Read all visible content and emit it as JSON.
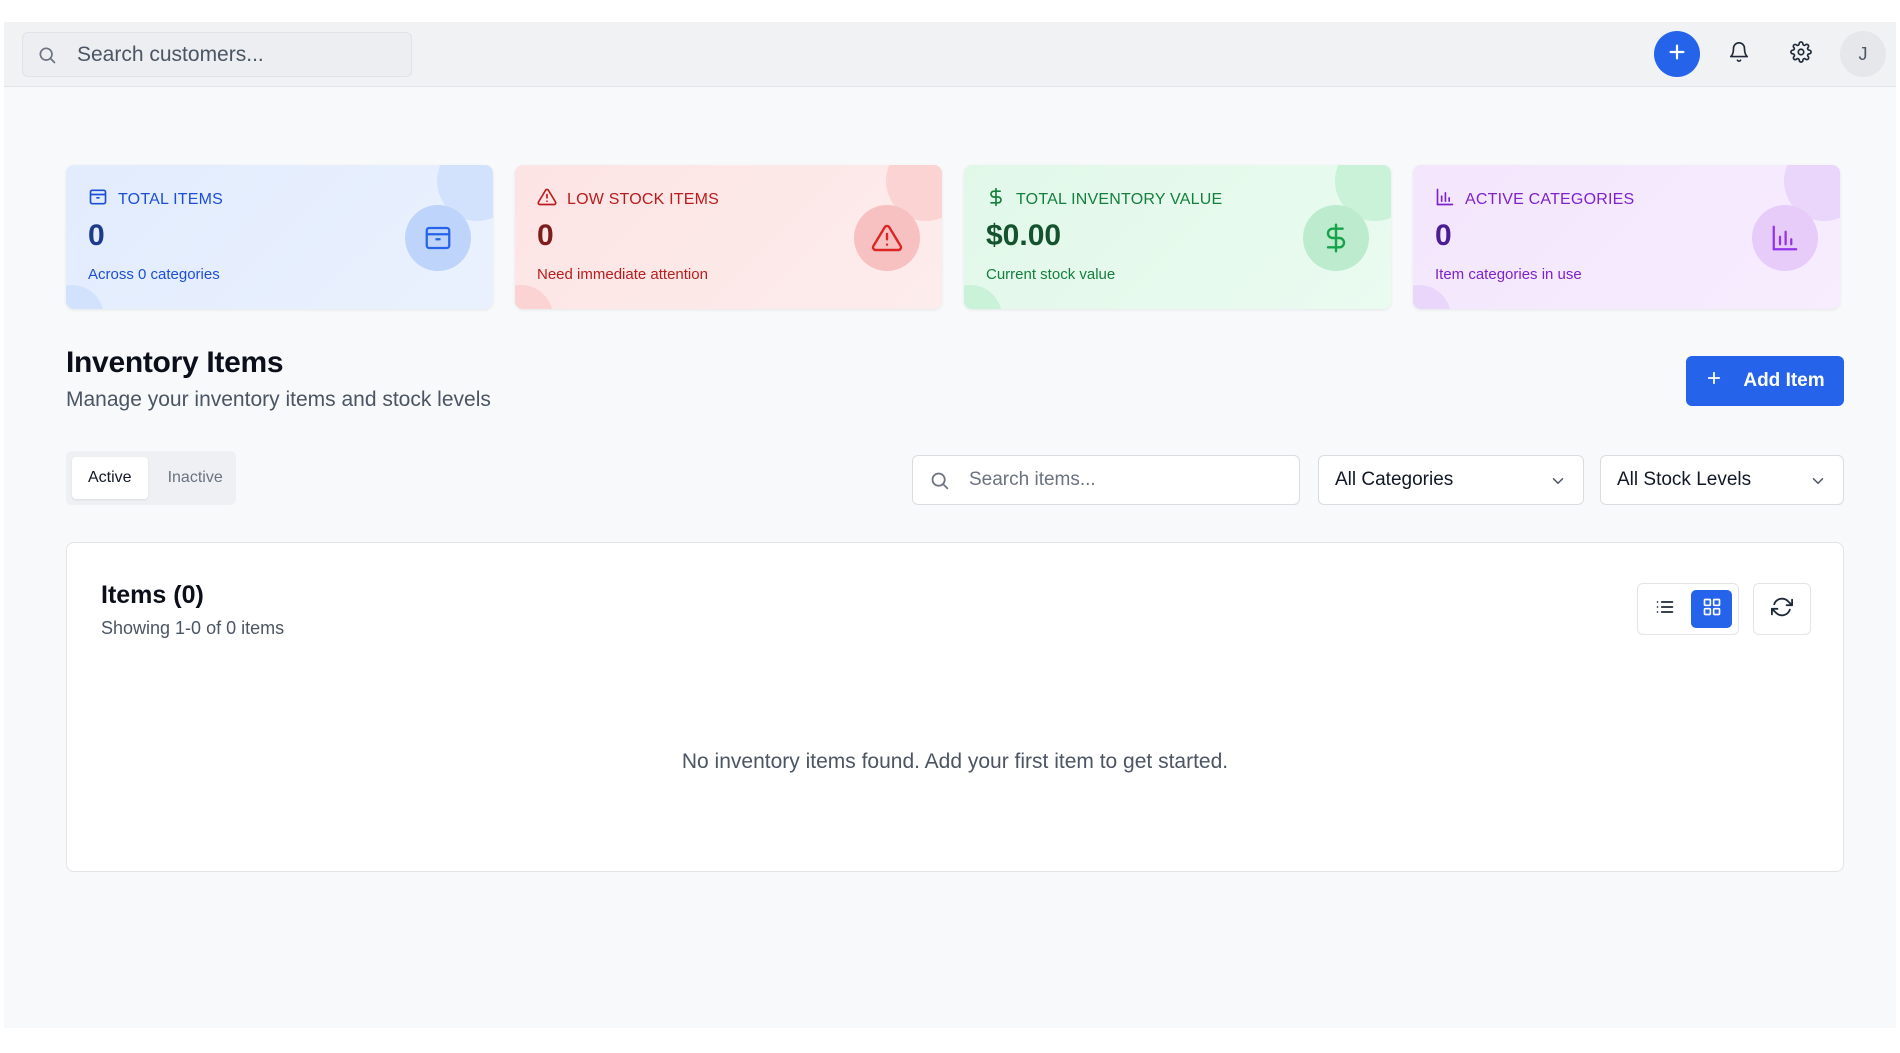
{
  "topbar": {
    "search_placeholder": "Search customers...",
    "avatar_initial": "J",
    "icons": [
      "search-icon",
      "plus-icon",
      "bell-icon",
      "gear-icon"
    ]
  },
  "stats": [
    {
      "label": "TOTAL ITEMS",
      "value": "0",
      "sub": "Across 0 categories",
      "icon": "package-icon",
      "theme": "blue"
    },
    {
      "label": "LOW STOCK ITEMS",
      "value": "0",
      "sub": "Need immediate attention",
      "icon": "alert-triangle-icon",
      "theme": "red"
    },
    {
      "label": "TOTAL INVENTORY VALUE",
      "value": "$0.00",
      "sub": "Current stock value",
      "icon": "dollar-icon",
      "theme": "green"
    },
    {
      "label": "ACTIVE CATEGORIES",
      "value": "0",
      "sub": "Item categories in use",
      "icon": "bar-chart-icon",
      "theme": "purple"
    }
  ],
  "section": {
    "title": "Inventory Items",
    "subtitle": "Manage your inventory items and stock levels",
    "add_label": "Add Item"
  },
  "tabs": [
    {
      "label": "Active",
      "active": true
    },
    {
      "label": "Inactive",
      "active": false
    }
  ],
  "filters": {
    "search_placeholder": "Search items...",
    "category_selected": "All Categories",
    "stock_selected": "All Stock Levels"
  },
  "panel": {
    "title": "Items (0)",
    "subtitle": "Showing 1-0 of 0 items",
    "view_mode": "grid",
    "empty_message": "No inventory items found. Add your first item to get started."
  },
  "colors": {
    "primary": "#2563eb",
    "blue": "#1d4ed8",
    "red": "#b91c1c",
    "green": "#15803d",
    "purple": "#7e22ce"
  }
}
